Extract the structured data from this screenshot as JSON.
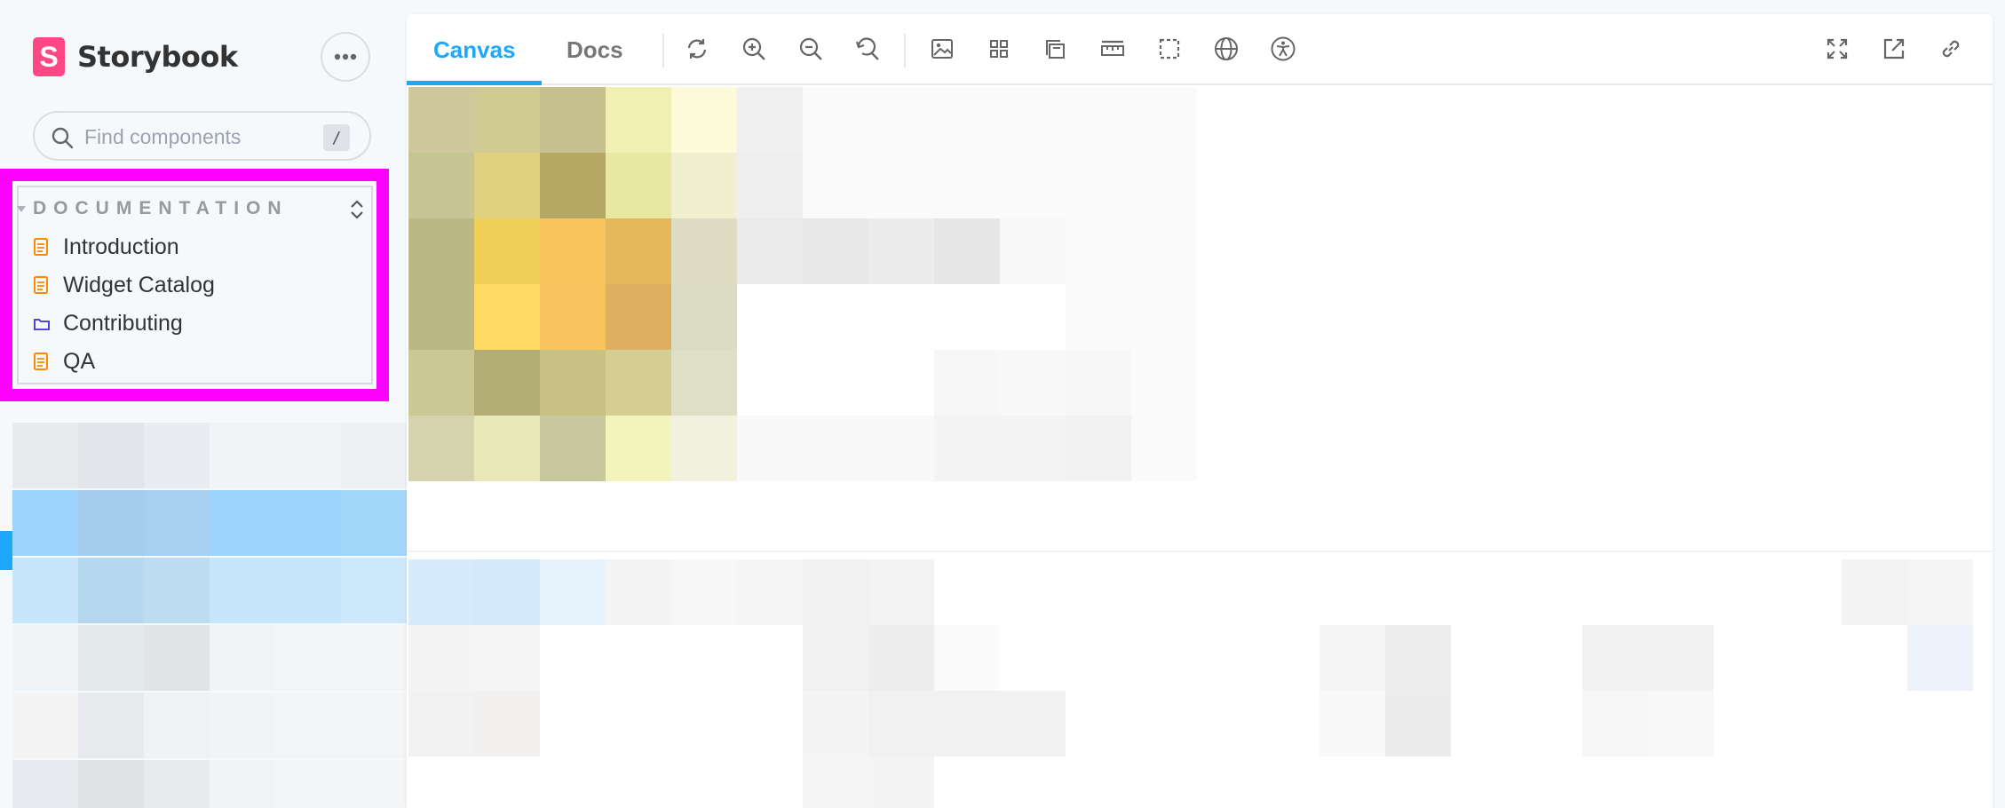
{
  "app": {
    "name": "Storybook",
    "logo_letter": "S",
    "brand_color": "#ff4785",
    "accent_color": "#1ea7fd",
    "highlight_color": "#ff00ff"
  },
  "sidebar": {
    "menu_icon": "ellipsis-icon",
    "search": {
      "placeholder": "Find components",
      "shortcut": "/",
      "icon": "search-icon"
    },
    "section": {
      "title": "DOCUMENTATION",
      "toggle_icon": "expand-collapse-icon",
      "items": [
        {
          "label": "Introduction",
          "icon": "document-icon"
        },
        {
          "label": "Widget Catalog",
          "icon": "document-icon"
        },
        {
          "label": "Contributing",
          "icon": "folder-icon"
        },
        {
          "label": "QA",
          "icon": "document-icon"
        }
      ]
    }
  },
  "toolbar": {
    "tabs": [
      {
        "label": "Canvas",
        "active": true
      },
      {
        "label": "Docs",
        "active": false
      }
    ],
    "tools": [
      "reload-icon",
      "zoom-in-icon",
      "zoom-out-icon",
      "zoom-reset-icon",
      "background-icon",
      "grid-icon",
      "viewport-icon",
      "measure-icon",
      "outline-icon",
      "globe-icon",
      "accessibility-icon"
    ],
    "right_tools": [
      "fullscreen-icon",
      "open-new-tab-icon",
      "copy-link-icon"
    ]
  }
}
